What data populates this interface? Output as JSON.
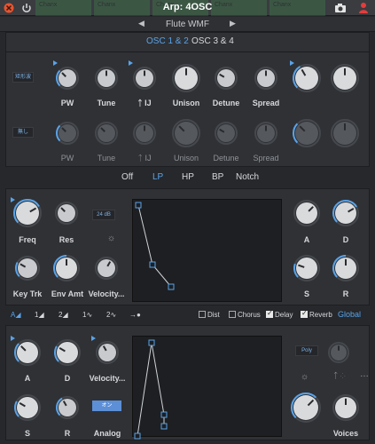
{
  "window": {
    "title": "Arp: 4OSC",
    "preset_name": "Flute WMF",
    "prev_arrow": "◀",
    "next_arrow": "▶"
  },
  "ghost_tabs": [
    "Chanx",
    "Chanx",
    "Chanx",
    "Chanx",
    "Chanx"
  ],
  "osc_tabs": {
    "active": "OSC 1 & 2",
    "other": "OSC 3 & 4"
  },
  "osc1": {
    "wave": "矩形波",
    "labels": [
      "PW",
      "Tune",
      "ᛏ IJ",
      "Unison",
      "Detune",
      "Spread"
    ]
  },
  "osc2": {
    "wave": "無し",
    "labels": [
      "PW",
      "Tune",
      "ᛏ IJ",
      "Unison",
      "Detune",
      "Spread"
    ]
  },
  "filter_types": [
    "Off",
    "LP",
    "HP",
    "BP",
    "Notch"
  ],
  "filter_active": "LP",
  "filter": {
    "slope": "24 dB",
    "labels": {
      "freq": "Freq",
      "res": "Res",
      "keytrk": "Key Trk",
      "envamt": "Env Amt",
      "velocity": "Velocity..."
    }
  },
  "filter_env": {
    "a": "A",
    "d": "D",
    "s": "S",
    "r": "R"
  },
  "fx_bar": {
    "lfo_tabs": [
      "A",
      "1",
      "2",
      "1",
      "2"
    ],
    "dist": "Dist",
    "chorus": "Chorus",
    "delay": "Delay",
    "reverb": "Reverb",
    "global": "Global"
  },
  "amp": {
    "a": "A",
    "d": "D",
    "velocity": "Velocity...",
    "s": "S",
    "r": "R",
    "analog": "Analog",
    "analog_toggle": "オン",
    "voice_mode": "Poly",
    "voices": "Voices"
  },
  "colors": {
    "accent": "#5aa3e8",
    "panel": "#2f3135",
    "bg": "#26282c"
  }
}
